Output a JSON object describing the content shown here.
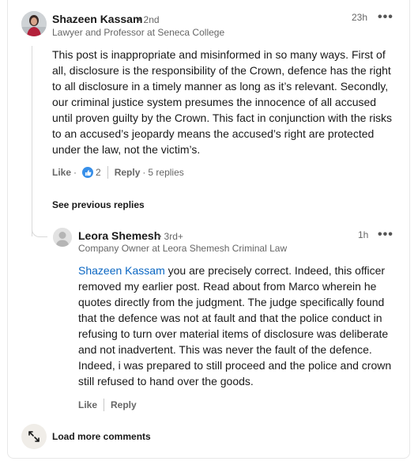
{
  "comment": {
    "author": "Shazeen Kassam",
    "degree": "• 2nd",
    "headline": "Lawyer and Professor at Seneca College",
    "time": "23h",
    "more_label": "•••",
    "lines": [
      "This post is inappropriate and misinformed in so many ways. First of",
      "all, disclosure is the responsibility of the Crown, defence has the right",
      "to all disclosure in a timely manner as long as it’s relevant. Secondly,",
      "our criminal justice system presumes the innocence of all accused",
      "until proven guilty by the Crown. This fact in conjunction with the risks",
      "to an accused’s jeopardy means the accused’s right are protected",
      "under the law, not the victim’s."
    ],
    "like_label": "Like",
    "dot": "·",
    "reaction_count": "2",
    "reply_label": "Reply",
    "replies_count": "5 replies"
  },
  "see_previous_label": "See previous replies",
  "reply": {
    "author": "Leora Shemesh",
    "degree": "• 3rd+",
    "headline": "Company Owner at Leora Shemesh Criminal Law",
    "time": "1h",
    "more_label": "•••",
    "mention": "Shazeen Kassam",
    "first_line_rest": " you are precisely correct. Indeed, this officer",
    "lines": [
      "removed my earlier post. Read about from Marco wherein he",
      "quotes directly from the judgment. The judge specifically found",
      "that the defence was not at fault and that the police conduct in",
      "refusing to turn over material items of disclosure was deliberate",
      "and not inadvertent. This was never the fault of the defence.",
      "Indeed, i was prepared to still proceed and the police and crown",
      "still refused to hand over the goods."
    ],
    "like_label": "Like",
    "reply_label": "Reply"
  },
  "load_more_label": "Load more comments",
  "colors": {
    "link": "#0a66c2",
    "like_reaction": "#378fe9",
    "text": "#191919",
    "muted": "#666666"
  }
}
